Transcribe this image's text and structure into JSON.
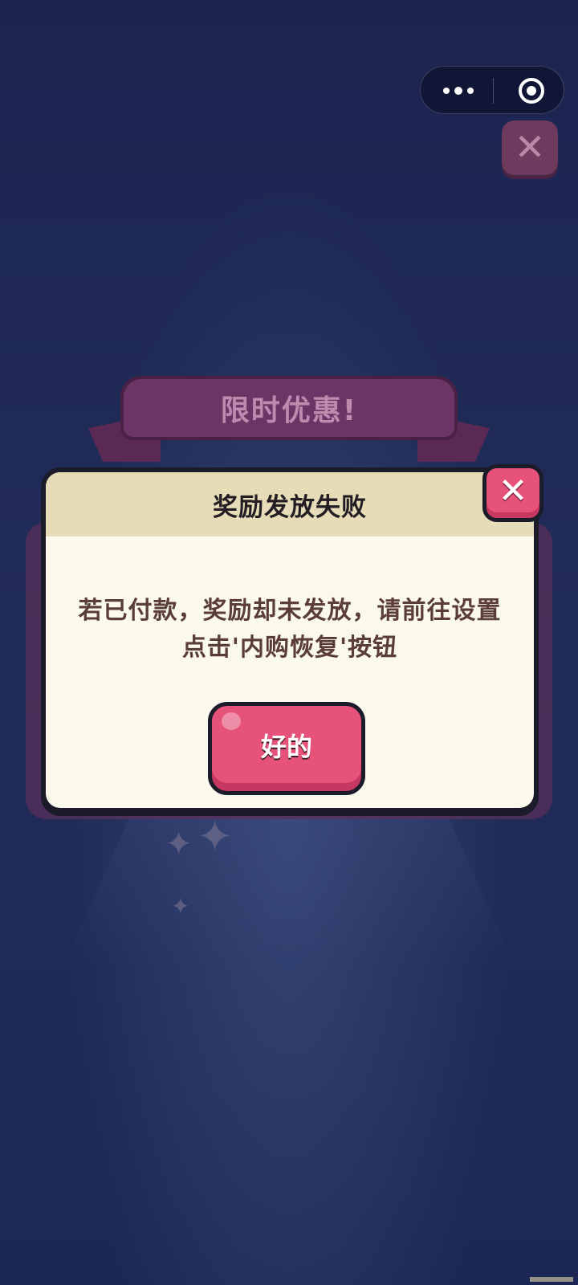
{
  "capsule": {
    "more_icon": "more-dots-icon",
    "close_icon": "target-circle-icon"
  },
  "background": {
    "banner_title": "限时优惠!",
    "close_icon": "close-icon"
  },
  "dialog": {
    "title": "奖励发放失败",
    "message": "若已付款，奖励却未发放，请前往设置点击'内购恢复'按钮",
    "ok_label": "好的",
    "close_icon": "close-icon",
    "close_glyph": "✕"
  },
  "colors": {
    "accent_pink": "#e7527a",
    "panel_cream": "#fbf9ec",
    "header_beige": "#e6dcb8",
    "background_navy": "#1f2a55"
  }
}
